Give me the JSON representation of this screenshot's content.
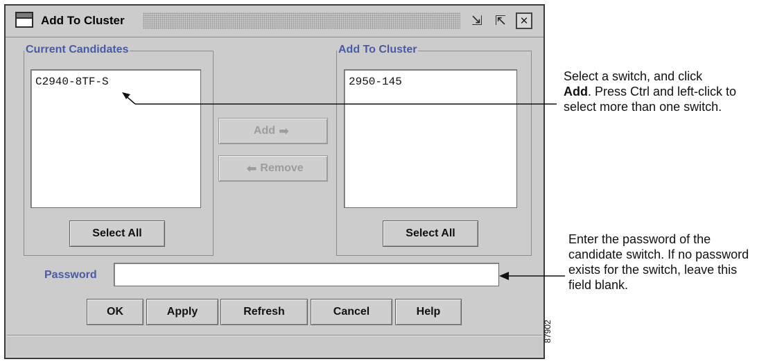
{
  "window": {
    "title": "Add To Cluster"
  },
  "current_candidates": {
    "legend": "Current Candidates",
    "items": [
      "C2940-8TF-S"
    ],
    "select_all_label": "Select All"
  },
  "add_to_cluster": {
    "legend": "Add To Cluster",
    "items": [
      "2950-145"
    ],
    "select_all_label": "Select All"
  },
  "transfer": {
    "add_label": "Add",
    "remove_label": "Remove"
  },
  "password": {
    "label": "Password",
    "value": ""
  },
  "buttons": {
    "ok": "OK",
    "apply": "Apply",
    "refresh": "Refresh",
    "cancel": "Cancel",
    "help": "Help"
  },
  "annotations": {
    "add_callout_line1": "Select a switch, and click",
    "add_callout_bold": "Add",
    "add_callout_rest": ". Press Ctrl and left-click to select more than one switch.",
    "password_callout": "Enter the password of the candidate switch. If no password exists for the switch, leave this field blank.",
    "figure_number": "87902"
  },
  "icons": {
    "window": "window-icon",
    "minimize": "minimize-icon",
    "maximize": "maximize-icon",
    "close": "close-icon",
    "add_arrow": "right-arrow-icon",
    "remove_arrow": "left-arrow-icon"
  }
}
